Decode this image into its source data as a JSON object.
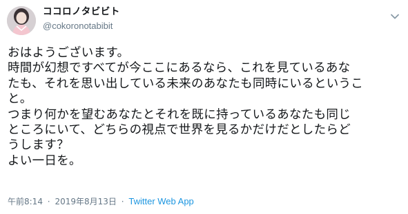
{
  "author": {
    "display_name": "ココロノタビビト",
    "handle": "@cokoronotabibit",
    "avatar_icon": "profile-avatar"
  },
  "menu_icon": "chevron-down-icon",
  "tweet": {
    "lines": [
      "おはようございます。",
      "時間が幻想ですべてが今ここにあるなら、これを見ているあな",
      "たも、それを思い出している未来のあなたも同時にいるというこ",
      "と。",
      "つまり何かを望むあなたとそれを既に持っているあなたも同じ",
      "ところにいて、どちらの視点で世界を見るかだけだとしたらど",
      "うします？",
      "よい一日を。"
    ]
  },
  "meta": {
    "time": "午前8:14",
    "separator": "·",
    "date": "2019年8月13日",
    "source": "Twitter Web App"
  },
  "colors": {
    "text": "#14171a",
    "secondary": "#657786",
    "link": "#1b95e0"
  }
}
